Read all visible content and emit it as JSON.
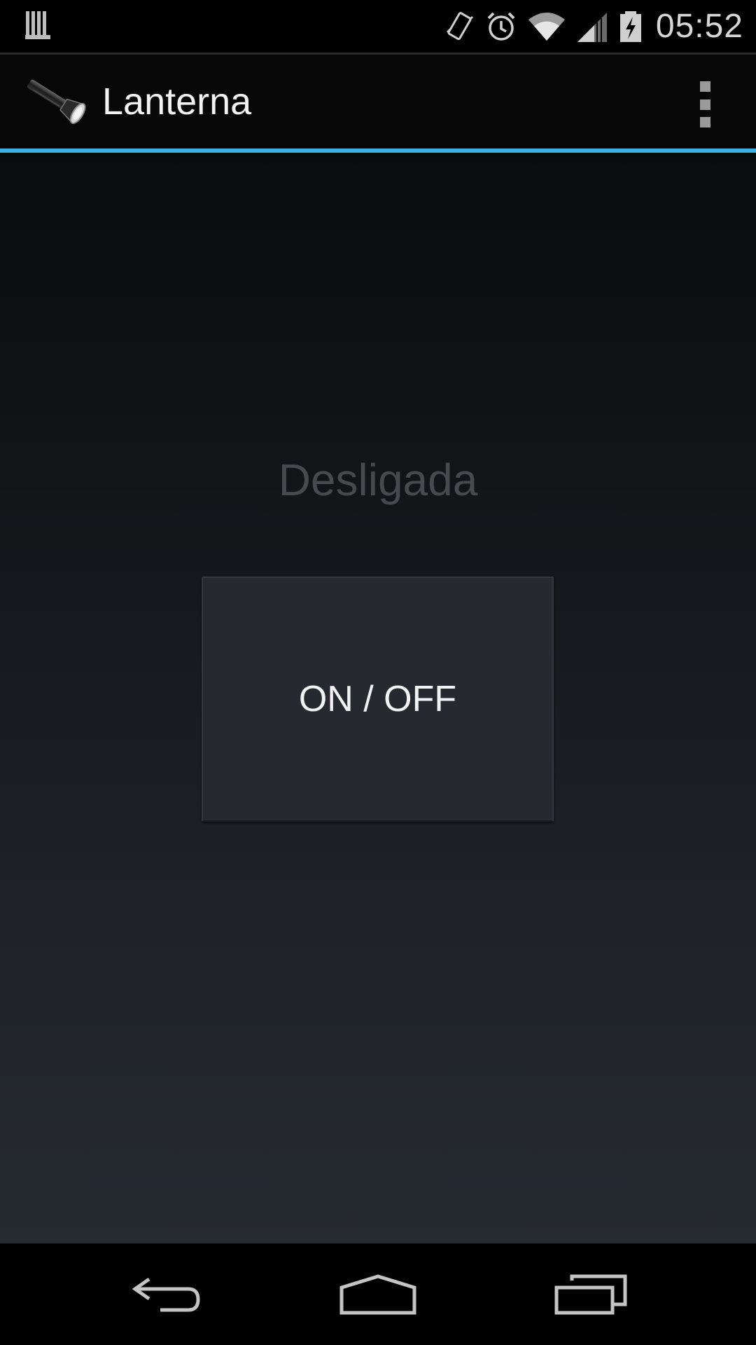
{
  "status_bar": {
    "time": "05:52",
    "icons": [
      "notification-bars-icon",
      "vibrate-icon",
      "alarm-icon",
      "wifi-icon",
      "cell-signal-icon",
      "battery-charging-icon"
    ]
  },
  "action_bar": {
    "title": "Lanterna",
    "app_icon": "flashlight-icon",
    "overflow_icon": "overflow-menu-icon"
  },
  "main": {
    "state_label": "Desligada",
    "toggle_label": "ON / OFF"
  },
  "nav_bar": {
    "buttons": [
      "back-icon",
      "home-icon",
      "recents-icon"
    ]
  },
  "colors": {
    "accent": "#33b5e5",
    "button_bg": "#262a30",
    "state_text": "#46494e"
  }
}
